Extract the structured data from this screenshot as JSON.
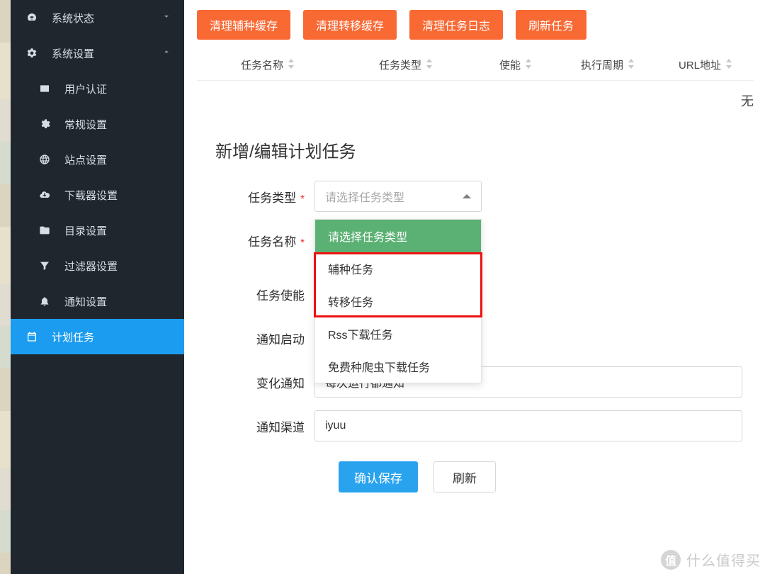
{
  "sidebar": {
    "top1": {
      "label": "系统状态"
    },
    "top2": {
      "label": "系统设置"
    },
    "sub": [
      {
        "label": "用户认证"
      },
      {
        "label": "常规设置"
      },
      {
        "label": "站点设置"
      },
      {
        "label": "下载器设置"
      },
      {
        "label": "目录设置"
      },
      {
        "label": "过滤器设置"
      },
      {
        "label": "通知设置"
      },
      {
        "label": "计划任务"
      }
    ]
  },
  "toolbar": {
    "btn1": "清理辅种缓存",
    "btn2": "清理转移缓存",
    "btn3": "清理任务日志",
    "btn4": "刷新任务"
  },
  "table": {
    "col1": "任务名称",
    "col2": "任务类型",
    "col3": "使能",
    "col4": "执行周期",
    "col5": "URL地址",
    "empty": "无"
  },
  "form": {
    "title": "新增/编辑计划任务",
    "labels": {
      "type": "任务类型",
      "name": "任务名称",
      "enable": "任务使能",
      "notify_on": "通知启动",
      "change_notify": "变化通知",
      "channel": "通知渠道"
    },
    "placeholders": {
      "type": "请选择任务类型"
    },
    "values": {
      "change_notify": "每次运行都通知",
      "channel": "iyuu"
    },
    "dropdown": {
      "header": "请选择任务类型",
      "opt1": "辅种任务",
      "opt2": "转移任务",
      "opt3": "Rss下载任务",
      "opt4": "免费种爬虫下载任务"
    },
    "actions": {
      "save": "确认保存",
      "refresh": "刷新"
    }
  },
  "watermark": {
    "logo": "值",
    "text": "什么值得买"
  }
}
